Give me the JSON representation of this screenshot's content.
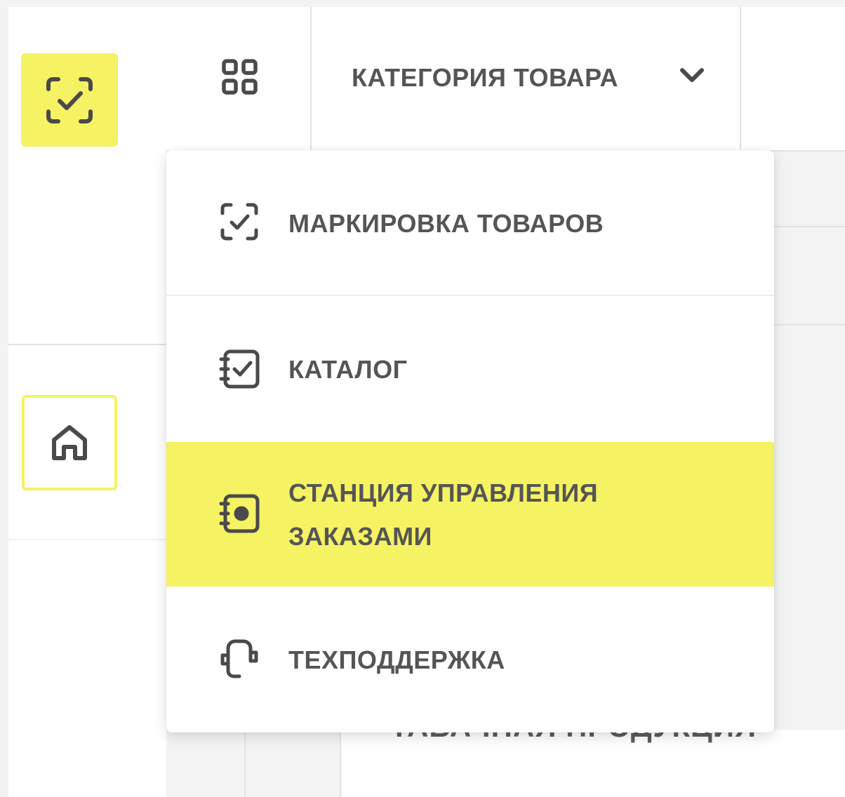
{
  "header": {
    "category_label": "КАТЕГОРИЯ ТОВАРА"
  },
  "background": {
    "partial_heading": "ТАБАЧНАЯ ПРОДУКЦИЯ"
  },
  "dropdown": {
    "items": [
      {
        "label": "МАРКИРОВКА ТОВАРОВ",
        "icon": "scan-check-icon"
      },
      {
        "label": "КАТАЛОГ",
        "icon": "catalog-check-icon"
      },
      {
        "label_line1": "СТАНЦИЯ УПРАВЛЕНИЯ",
        "label_line2": "ЗАКАЗАМИ",
        "icon": "order-station-icon",
        "active": true
      },
      {
        "label": "ТЕХПОДДЕРЖКА",
        "icon": "support-icon"
      }
    ]
  },
  "colors": {
    "accent": "#f5f263",
    "text": "#555555"
  }
}
